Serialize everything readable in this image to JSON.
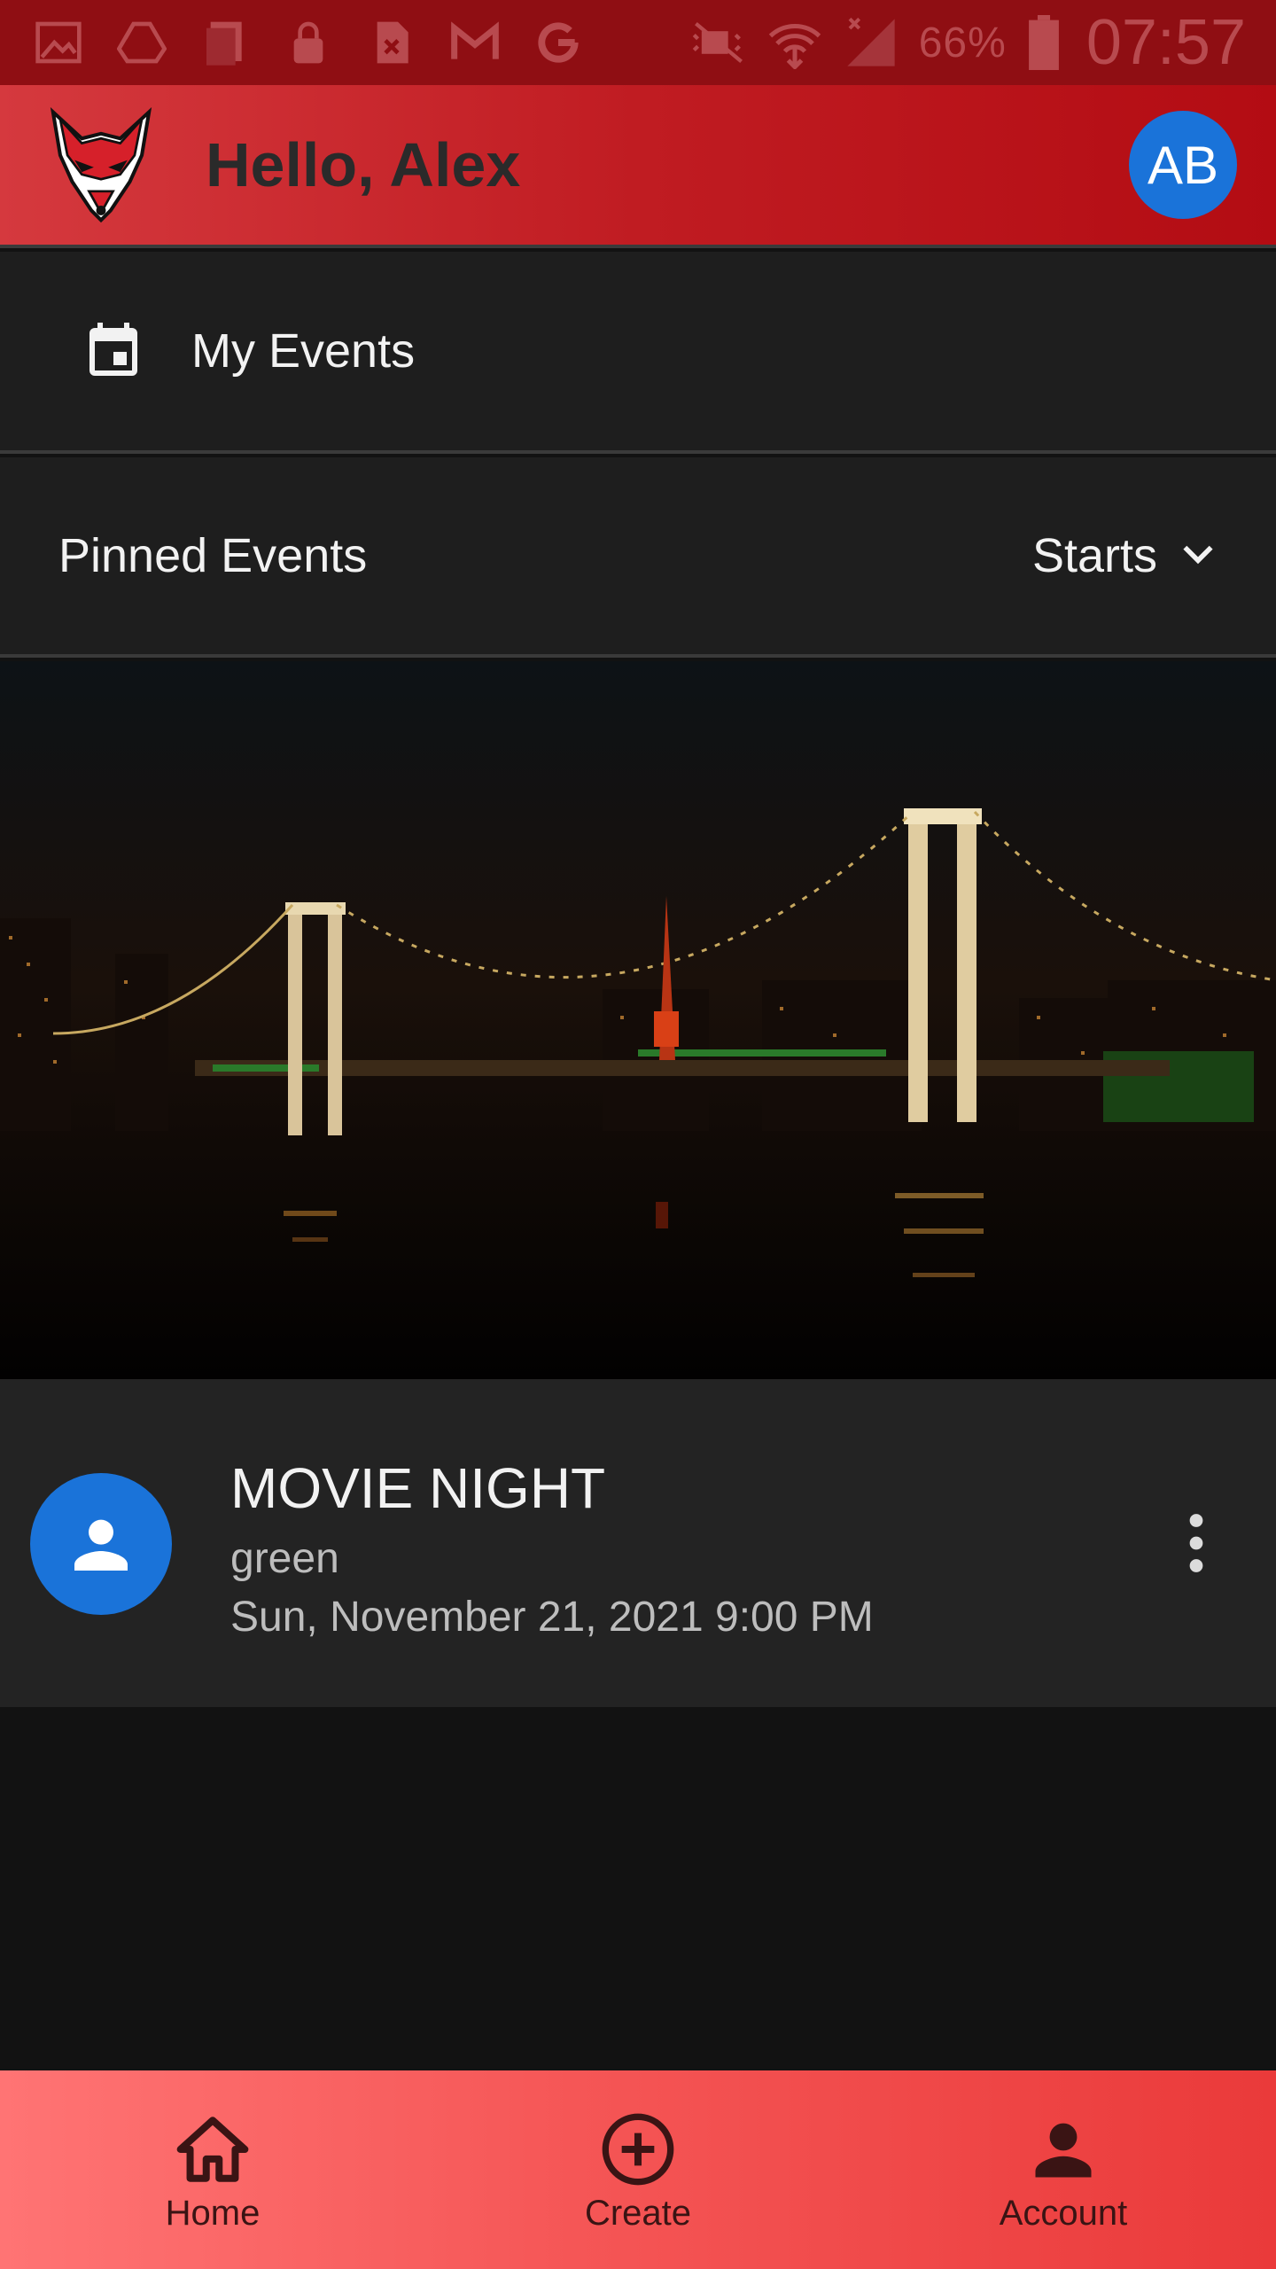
{
  "status_bar": {
    "battery_percent": "66%",
    "time": "07:57",
    "icons": [
      "gallery-icon",
      "drive-icon",
      "copy-icon",
      "lock-icon",
      "file-x-icon",
      "gmail-icon",
      "google-icon",
      "mute-icon",
      "wifi-icon",
      "signal-icon",
      "battery-icon"
    ]
  },
  "app_bar": {
    "greeting": "Hello, Alex",
    "avatar_initials": "AB",
    "logo": "fox-logo"
  },
  "my_events": {
    "label": "My Events",
    "icon": "calendar-icon"
  },
  "pinned": {
    "title": "Pinned Events",
    "sort_label": "Starts",
    "sort_icon": "chevron-down-icon"
  },
  "event": {
    "title": "MOVIE NIGHT",
    "subtitle": "green",
    "datetime": "Sun, November 21, 2021 9:00 PM",
    "avatar_icon": "person-icon",
    "menu_icon": "more-vert-icon"
  },
  "bottom_nav": {
    "items": [
      {
        "label": "Home",
        "icon": "home-icon"
      },
      {
        "label": "Create",
        "icon": "add-circle-icon"
      },
      {
        "label": "Account",
        "icon": "account-icon"
      }
    ]
  },
  "colors": {
    "app_bar": "#c01c22",
    "status_bar": "#8f0e13",
    "avatar": "#1a73d9",
    "bottom_nav": "#f55656",
    "background": "#121212",
    "card": "#232323"
  }
}
